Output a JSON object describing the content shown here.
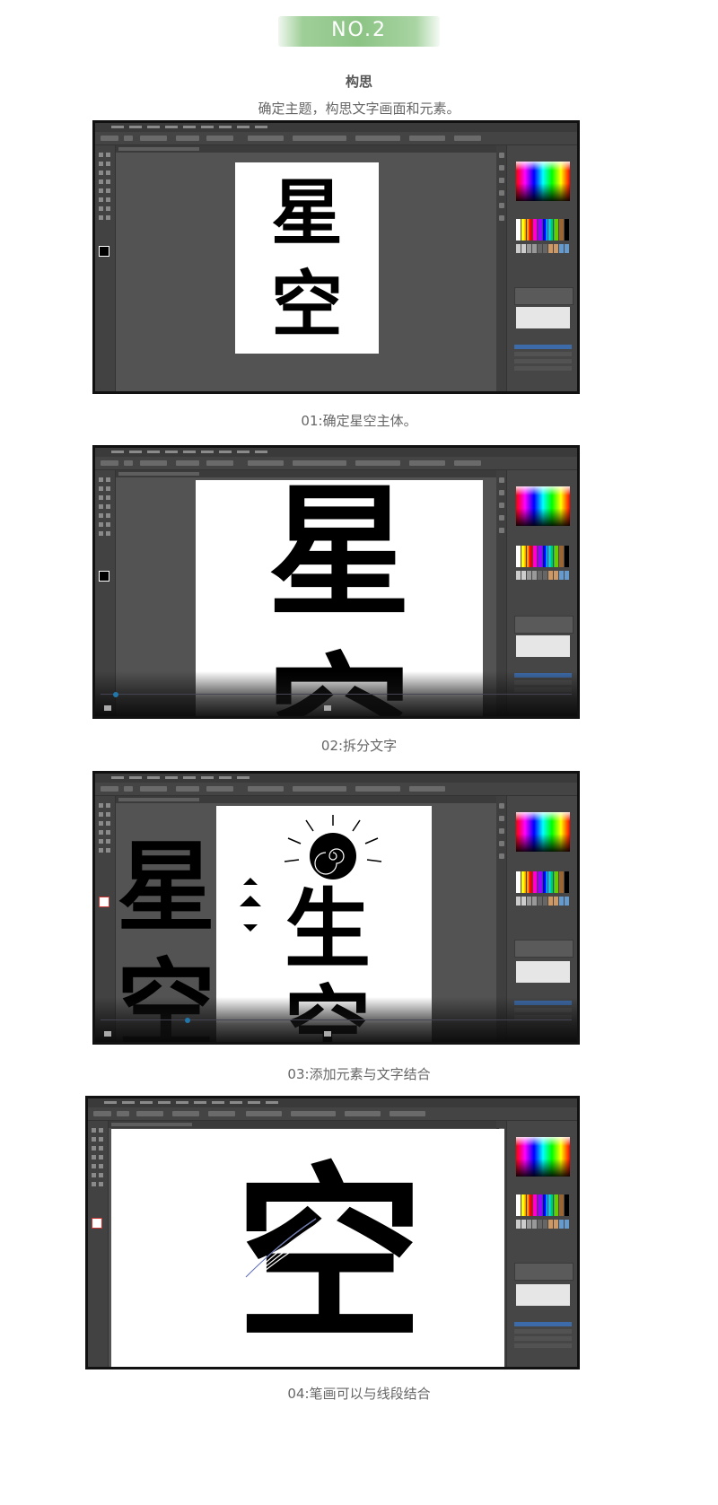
{
  "section": {
    "badge": "NO.2",
    "title": "构思",
    "subtitle": "确定主题，构思文字画面和元素。"
  },
  "steps": [
    {
      "caption": "01:确定星空主体。",
      "chars": [
        "星",
        "空"
      ]
    },
    {
      "caption": "02:拆分文字",
      "chars": [
        "星",
        "空"
      ]
    },
    {
      "caption": "03:添加元素与文字结合",
      "chars": [
        "星",
        "空"
      ]
    },
    {
      "caption": "04:笔画可以与线段结合",
      "chars": [
        "空"
      ]
    }
  ],
  "colors": {
    "badge_green": "#8cc485",
    "workspace": "#535353",
    "artboard": "#ffffff",
    "glyph": "#000000",
    "selection_blue": "#3d6aa8"
  },
  "icons": [
    "toolbar-tool-icon",
    "panel-tab-icon",
    "play-icon",
    "volume-icon"
  ]
}
